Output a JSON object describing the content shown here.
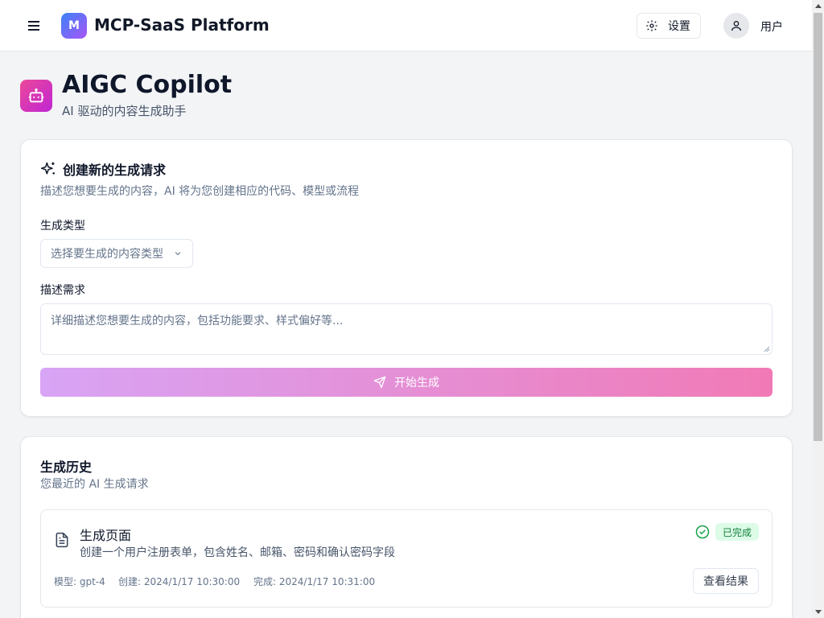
{
  "header": {
    "brand_initial": "M",
    "brand_name": "MCP-SaaS Platform",
    "settings_label": "设置",
    "user_label": "用户"
  },
  "page": {
    "title": "AIGC Copilot",
    "subtitle": "AI 驱动的内容生成助手"
  },
  "create_card": {
    "title": "创建新的生成请求",
    "description": "描述您想要生成的内容，AI 将为您创建相应的代码、模型或流程",
    "type_label": "生成类型",
    "type_placeholder": "选择要生成的内容类型",
    "desc_label": "描述需求",
    "desc_placeholder": "详细描述您想要生成的内容，包括功能要求、样式偏好等...",
    "submit_label": "开始生成"
  },
  "history": {
    "title": "生成历史",
    "description": "您最近的 AI 生成请求",
    "items": [
      {
        "title": "生成页面",
        "description": "创建一个用户注册表单，包含姓名、邮箱、密码和确认密码字段",
        "status": "已完成",
        "model": "模型: gpt-4",
        "created": "创建: 2024/1/17 10:30:00",
        "completed": "完成: 2024/1/17 10:31:00",
        "view_label": "查看结果"
      }
    ]
  },
  "colors": {
    "brand_gradient_start": "#3b82f6",
    "brand_gradient_end": "#a855f7",
    "page_icon_start": "#ec4899",
    "page_icon_end": "#c026d3",
    "submit_start": "#d8a4f5",
    "submit_end": "#f17ab6",
    "status_bg": "#dcfce7",
    "status_text": "#15803d"
  },
  "icons": {
    "menu": "menu-icon",
    "settings": "gear-icon",
    "user": "user-icon",
    "page": "bot-icon",
    "sparkles": "sparkles-icon",
    "chevron": "chevron-down-icon",
    "send": "send-icon",
    "document": "document-icon",
    "status": "check-circle-icon"
  }
}
